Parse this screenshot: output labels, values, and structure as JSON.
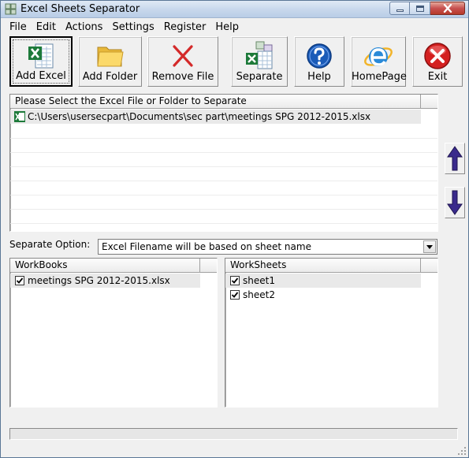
{
  "window": {
    "title": "Excel Sheets Separator"
  },
  "menu": [
    "File",
    "Edit",
    "Actions",
    "Settings",
    "Register",
    "Help"
  ],
  "toolbar": {
    "add_excel": "Add Excel",
    "add_folder": "Add Folder",
    "remove_file": "Remove File",
    "separate": "Separate",
    "help": "Help",
    "homepage": "HomePage",
    "exit": "Exit"
  },
  "files": {
    "header": "Please Select the Excel File or Folder to Separate",
    "items": [
      "C:\\Users\\usersecpart\\Documents\\sec part\\meetings SPG 2012-2015.xlsx"
    ]
  },
  "separate_option": {
    "label": "Separate Option:",
    "selected": "Excel Filename will be based on sheet name"
  },
  "workbooks": {
    "header": "WorkBooks",
    "items": [
      {
        "name": "meetings SPG 2012-2015.xlsx",
        "checked": true
      }
    ]
  },
  "worksheets": {
    "header": "WorkSheets",
    "items": [
      {
        "name": "sheet1",
        "checked": true
      },
      {
        "name": "sheet2",
        "checked": true
      }
    ]
  },
  "progress": {
    "value": 0
  },
  "colors": {
    "accent_purple": "#3a2a8c",
    "excel_green": "#1d7a3a",
    "exit_red": "#d42020",
    "help_blue": "#1a5bb8"
  }
}
